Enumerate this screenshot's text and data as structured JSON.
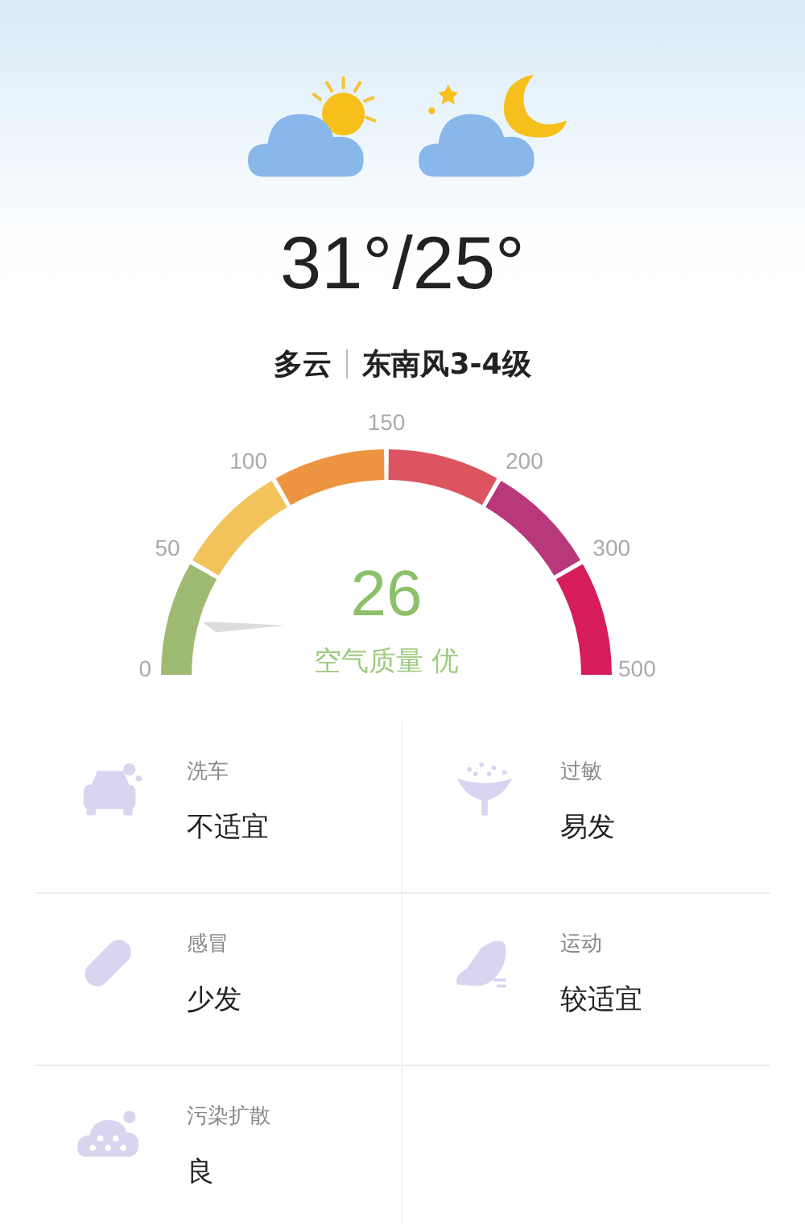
{
  "temperature": "31°/25°",
  "condition": {
    "weather": "多云",
    "wind": "东南风3-4级"
  },
  "aqi_gauge": {
    "value": "26",
    "label": "空气质量 优",
    "segments": [
      {
        "color": "#9fba72"
      },
      {
        "color": "#f3c45c"
      },
      {
        "color": "#ec9440"
      },
      {
        "color": "#dc5460"
      },
      {
        "color": "#b8387c"
      },
      {
        "color": "#d61c5c"
      }
    ],
    "ticks": [
      "0",
      "50",
      "100",
      "150",
      "200",
      "300",
      "500"
    ]
  },
  "indices": [
    {
      "name": "洗车",
      "value": "不适宜"
    },
    {
      "name": "过敏",
      "value": "易发"
    },
    {
      "name": "感冒",
      "value": "少发"
    },
    {
      "name": "运动",
      "value": "较适宜"
    },
    {
      "name": "污染扩散",
      "value": "良"
    }
  ]
}
